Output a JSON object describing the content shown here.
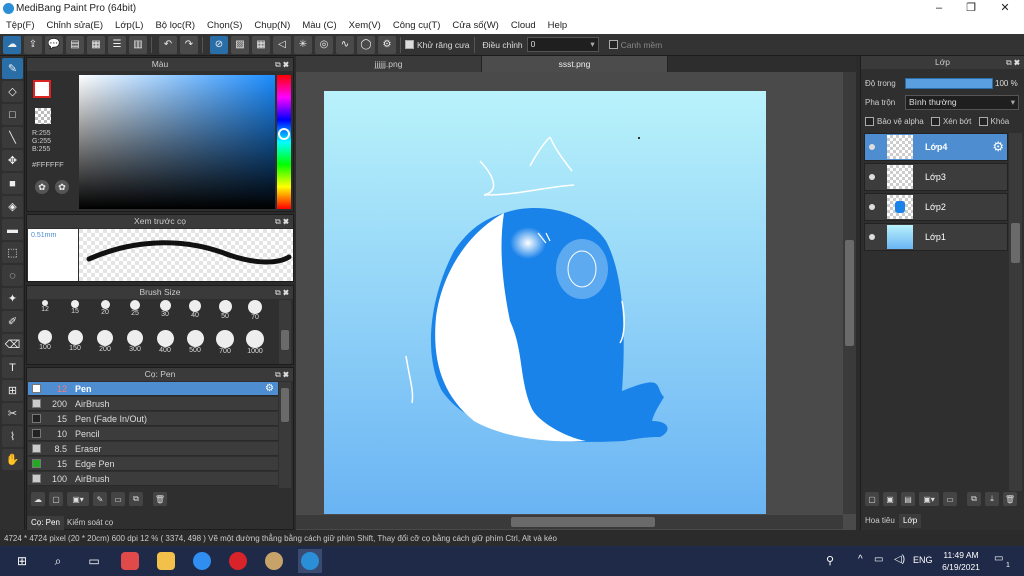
{
  "window": {
    "title": "MediBang Paint Pro (64bit)",
    "minimize": "–",
    "maximize": "❐",
    "close": "✕"
  },
  "menu": [
    "Tệp(F)",
    "Chỉnh sửa(E)",
    "Lớp(L)",
    "Bộ lọc(R)",
    "Chọn(S)",
    "Chụp(N)",
    "Màu (C)",
    "Xem(V)",
    "Công cụ(T)",
    "Cửa số(W)",
    "Cloud",
    "Help"
  ],
  "toolbar": {
    "antialias_label": "Khử răng cưa",
    "correction_label": "Điều chỉnh",
    "correction_value": "0",
    "edge_label": "Canh mềm"
  },
  "color_panel": {
    "title": "Màu",
    "r": "R:255",
    "g": "G:255",
    "b": "B:255",
    "hex": "#FFFFFF"
  },
  "preview_panel": {
    "title": "Xem trước cọ",
    "size": "0.51mm"
  },
  "size_panel": {
    "title": "Brush Size",
    "row1": [
      "12",
      "15",
      "20",
      "25",
      "30",
      "40",
      "50",
      "70"
    ],
    "row2": [
      "100",
      "150",
      "200",
      "300",
      "400",
      "500",
      "700",
      "1000"
    ]
  },
  "brush_panel": {
    "title": "Cọ: Pen",
    "items": [
      {
        "size": "12",
        "name": "Pen",
        "color": "#ffffff"
      },
      {
        "size": "200",
        "name": "AirBrush",
        "color": "#cccccc"
      },
      {
        "size": "15",
        "name": "Pen (Fade In/Out)",
        "color": "#222222"
      },
      {
        "size": "10",
        "name": "Pencil",
        "color": "#222222"
      },
      {
        "size": "8.5",
        "name": "Eraser",
        "color": "#cccccc"
      },
      {
        "size": "15",
        "name": "Edge Pen",
        "color": "#22aa22"
      },
      {
        "size": "100",
        "name": "AirBrush",
        "color": "#cccccc"
      }
    ],
    "tab_brush": "Cọ: Pen",
    "tab_control": "Kiểm soát cọ"
  },
  "tabs": [
    "jjjjjj.png",
    "ssst.png"
  ],
  "layer_panel": {
    "title": "Lớp",
    "opacity_label": "Độ trong",
    "opacity_value": "100 %",
    "blend_label": "Pha trộn",
    "blend_value": "Bình thường",
    "protect_alpha": "Bảo vệ alpha",
    "clipping": "Xén bớt",
    "lock": "Khóa",
    "layers": [
      "Lớp4",
      "Lớp3",
      "Lớp2",
      "Lớp1"
    ],
    "tab_material": "Hoa tiêu",
    "tab_layer": "Lớp"
  },
  "status": {
    "text": "4724 * 4724 pixel   (20 * 20cm)   600 dpi   12 %   ( 3374, 498 )   Vẽ một đường thẳng bằng cách giữ phím Shift, Thay đổi cỡ cọ bằng cách giữ phím Ctrl, Alt và kéo"
  },
  "taskbar": {
    "lang": "ENG",
    "time": "11:49 AM",
    "date": "6/19/2021",
    "notif": "1"
  }
}
